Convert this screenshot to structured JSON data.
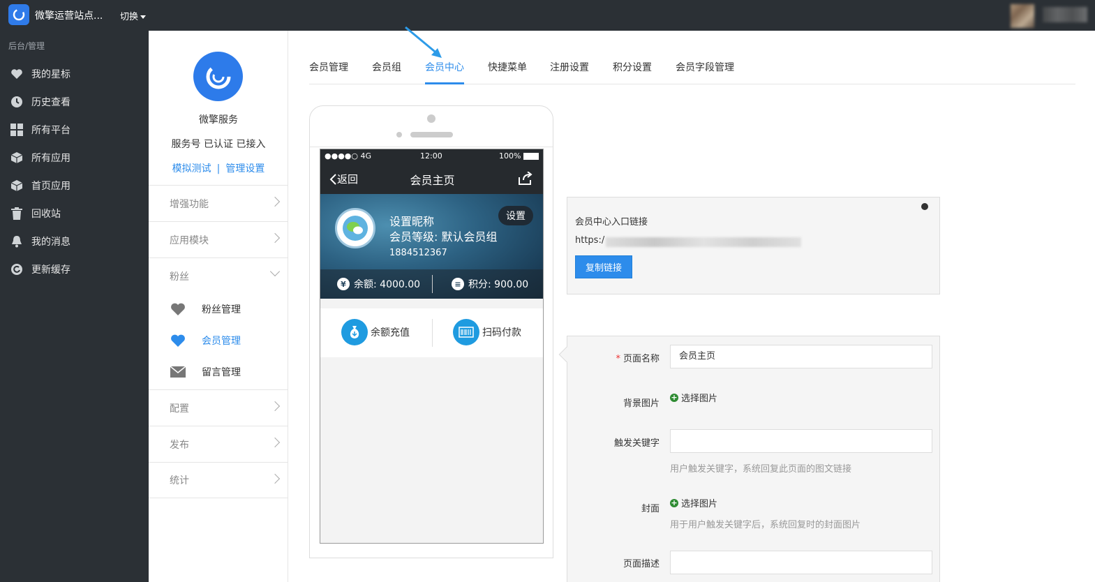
{
  "topbar": {
    "site_name": "微擎运营站点...",
    "switch_label": "切换"
  },
  "sidebar": {
    "breadcrumb": "后台/管理",
    "items": [
      {
        "label": "我的星标",
        "icon": "heart-icon"
      },
      {
        "label": "历史查看",
        "icon": "clock-icon"
      },
      {
        "label": "所有平台",
        "icon": "grid-icon"
      },
      {
        "label": "所有应用",
        "icon": "cube-icon"
      },
      {
        "label": "首页应用",
        "icon": "cube-icon"
      },
      {
        "label": "回收站",
        "icon": "trash-icon"
      },
      {
        "label": "我的消息",
        "icon": "bell-icon"
      },
      {
        "label": "更新缓存",
        "icon": "refresh-icon"
      }
    ]
  },
  "account": {
    "name": "微擎服务",
    "status": "服务号 已认证 已接入",
    "link_test": "模拟测试",
    "link_sep": "|",
    "link_manage": "管理设置"
  },
  "col2_menu": {
    "enhance": "增强功能",
    "modules": "应用模块",
    "fans": "粉丝",
    "fans_manage": "粉丝管理",
    "member_manage": "会员管理",
    "message_manage": "留言管理",
    "config": "配置",
    "publish": "发布",
    "stats": "统计"
  },
  "tabs": [
    {
      "label": "会员管理"
    },
    {
      "label": "会员组"
    },
    {
      "label": "会员中心"
    },
    {
      "label": "快捷菜单"
    },
    {
      "label": "注册设置"
    },
    {
      "label": "积分设置"
    },
    {
      "label": "会员字段管理"
    }
  ],
  "phone": {
    "signal": "●●●●○ 4G",
    "time": "12:00",
    "battery": "100%",
    "back": "返回",
    "title": "会员主页",
    "nickname": "设置昵称",
    "level": "会员等级: 默认会员组",
    "phone_no": "1884512367",
    "settings_btn": "设置",
    "yen": "¥",
    "balance": "余额: 4000.00",
    "points": "积分: 900.00",
    "recharge": "余额充值",
    "scan_pay": "扫码付款"
  },
  "linkbox": {
    "title": "会员中心入口链接",
    "url_prefix": "https:/",
    "copy_button": "复制链接"
  },
  "form": {
    "required_mark": "*",
    "page_name_label": "页面名称",
    "page_name_value": "会员主页",
    "bg_image_label": "背景图片",
    "select_image": "选择图片",
    "keyword_label": "触发关键字",
    "keyword_value": "",
    "keyword_help": "用户触发关键字，系统回复此页面的图文链接",
    "cover_label": "封面",
    "cover_help": "用于用户触发关键字后，系统回复时的封面图片",
    "desc_label": "页面描述",
    "desc_value": ""
  },
  "colors": {
    "accent": "#2d8ceb",
    "topbar_bg": "#2b3035",
    "sidebar_bg": "#2b3035"
  }
}
